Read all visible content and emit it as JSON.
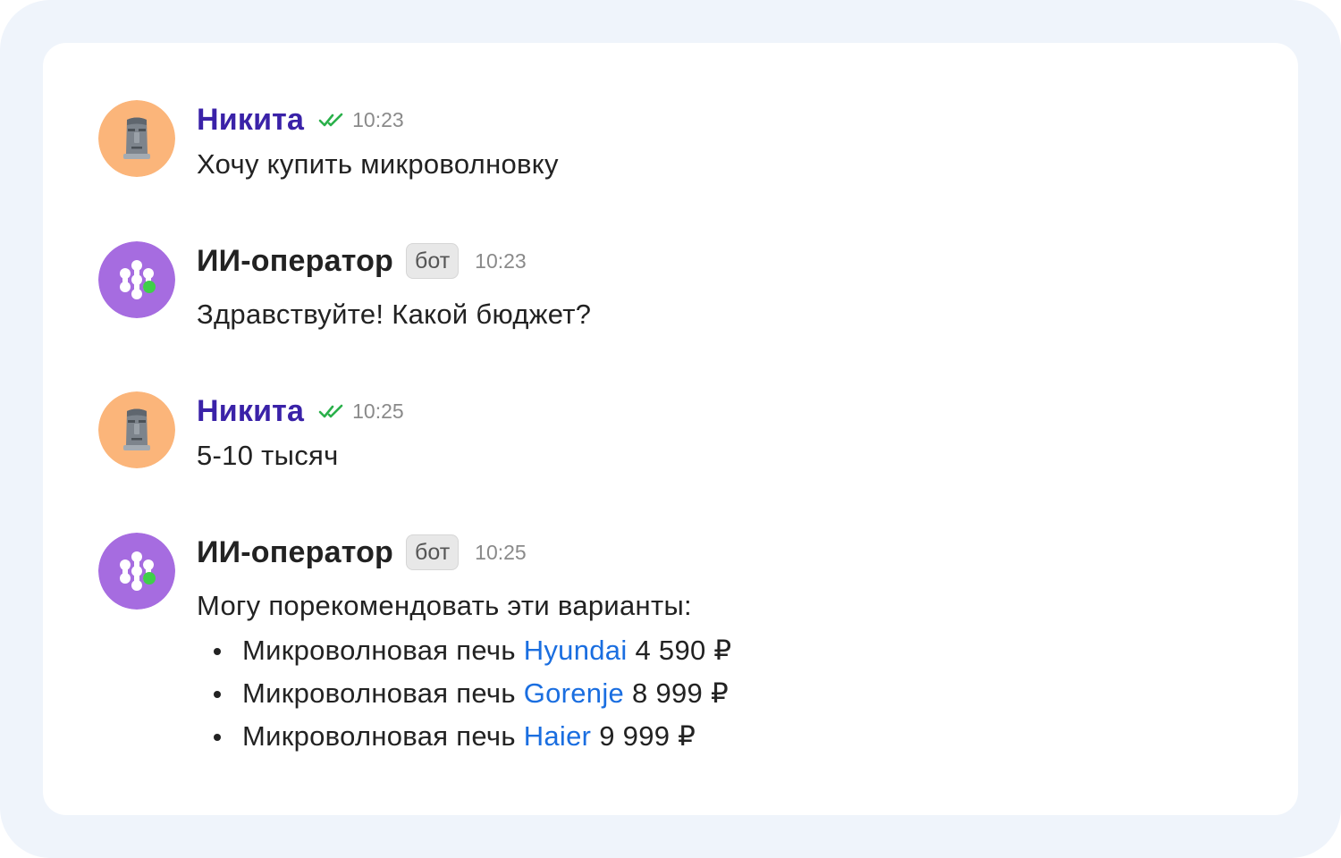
{
  "messages": [
    {
      "author": "Никита",
      "time": "10:23",
      "text": "Хочу купить микроволновку"
    },
    {
      "author": "ИИ-оператор",
      "badge": "бот",
      "time": "10:23",
      "text": "Здравствуйте! Какой бюджет?"
    },
    {
      "author": "Никита",
      "time": "10:25",
      "text": "5-10 тысяч"
    },
    {
      "author": "ИИ-оператор",
      "badge": "бот",
      "time": "10:25",
      "text": "Могу порекомендовать эти варианты:",
      "options": [
        {
          "prefix": "Микроволновая печь ",
          "brand": "Hyundai",
          "price": " 4 590 ₽"
        },
        {
          "prefix": "Микроволновая печь ",
          "brand": "Gorenje",
          "price": " 8 999 ₽"
        },
        {
          "prefix": "Микроволновая печь ",
          "brand": "Haier",
          "price": " 9 999  ₽"
        }
      ]
    }
  ],
  "icons": {
    "user_avatar": "moai-icon",
    "bot_avatar": "bot-logo-icon",
    "read_status": "double-check-icon",
    "online_status": "online-dot-icon"
  },
  "colors": {
    "user_name": "#3a22a8",
    "link": "#1a6ee0",
    "read_check": "#2ab04a",
    "online_dot": "#3fcf4a",
    "user_avatar_bg": "#fbb57a",
    "bot_avatar_bg": "#a66ce0"
  }
}
